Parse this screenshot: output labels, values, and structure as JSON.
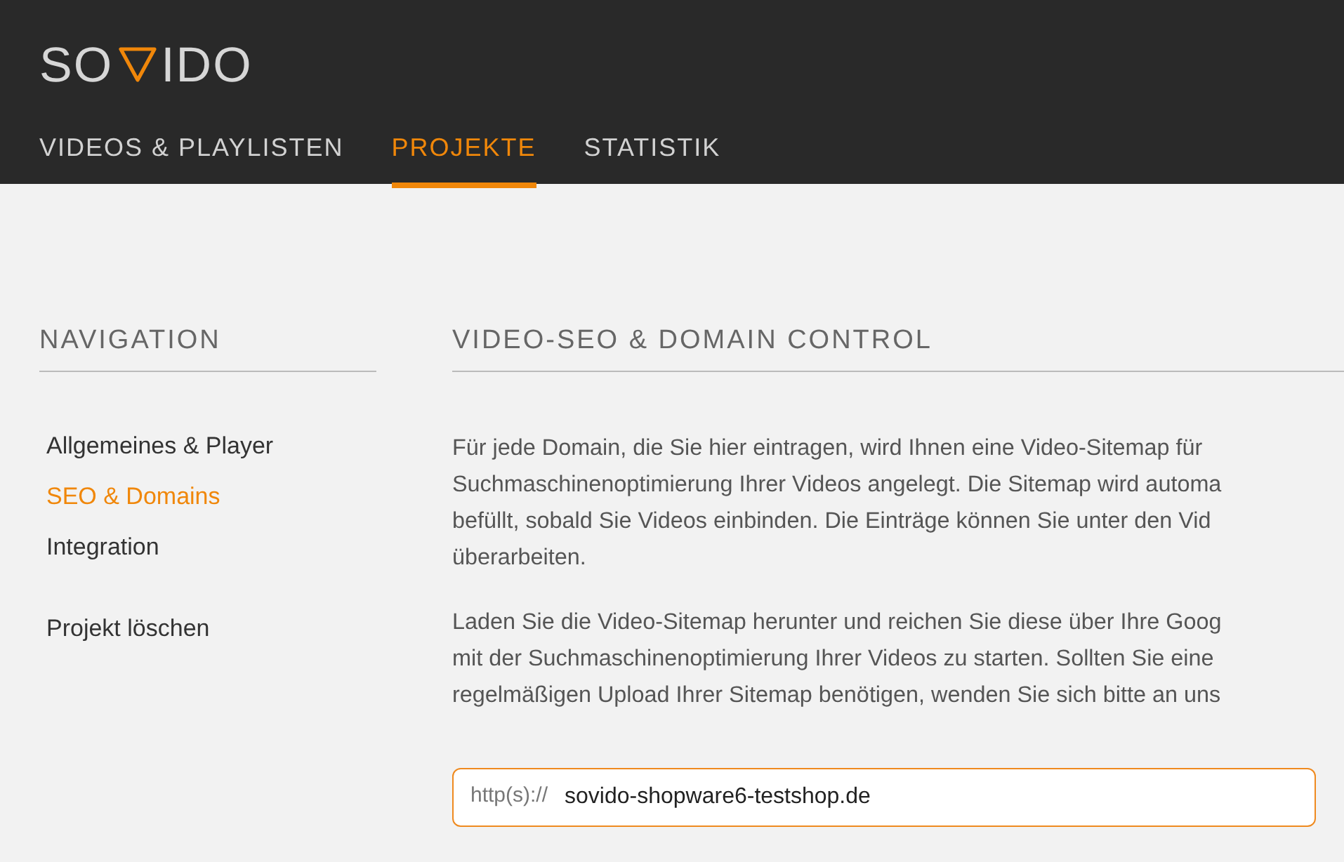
{
  "logo": {
    "left": "SO",
    "right": "IDO"
  },
  "tabs": [
    {
      "label": "VIDEOS & PLAYLISTEN",
      "selected": false
    },
    {
      "label": "PROJEKTE",
      "selected": true
    },
    {
      "label": "STATISTIK",
      "selected": false
    }
  ],
  "sidebar": {
    "title": "NAVIGATION",
    "items": [
      {
        "label": "Allgemeines & Player",
        "selected": false
      },
      {
        "label": "SEO & Domains",
        "selected": true
      },
      {
        "label": "Integration",
        "selected": false
      }
    ],
    "extra_items": [
      {
        "label": "Projekt löschen",
        "selected": false
      }
    ]
  },
  "main": {
    "title": "VIDEO-SEO & DOMAIN CONTROL",
    "paragraphs": [
      [
        "Für jede Domain, die Sie hier eintragen, wird Ihnen eine Video-Sitemap für",
        "Suchmaschinenoptimierung Ihrer Videos angelegt. Die Sitemap wird automa",
        "befüllt, sobald Sie Videos einbinden. Die Einträge können Sie unter den Vid",
        "überarbeiten."
      ],
      [
        "Laden Sie die Video-Sitemap herunter und reichen Sie diese über Ihre Goog",
        "mit der Suchmaschinenoptimierung Ihrer Videos zu starten. Sollten Sie eine",
        "regelmäßigen Upload Ihrer Sitemap benötigen, wenden Sie sich bitte an uns"
      ]
    ],
    "domain_field": {
      "prefix": "http(s)://",
      "value": "sovido-shopware6-testshop.de"
    }
  }
}
